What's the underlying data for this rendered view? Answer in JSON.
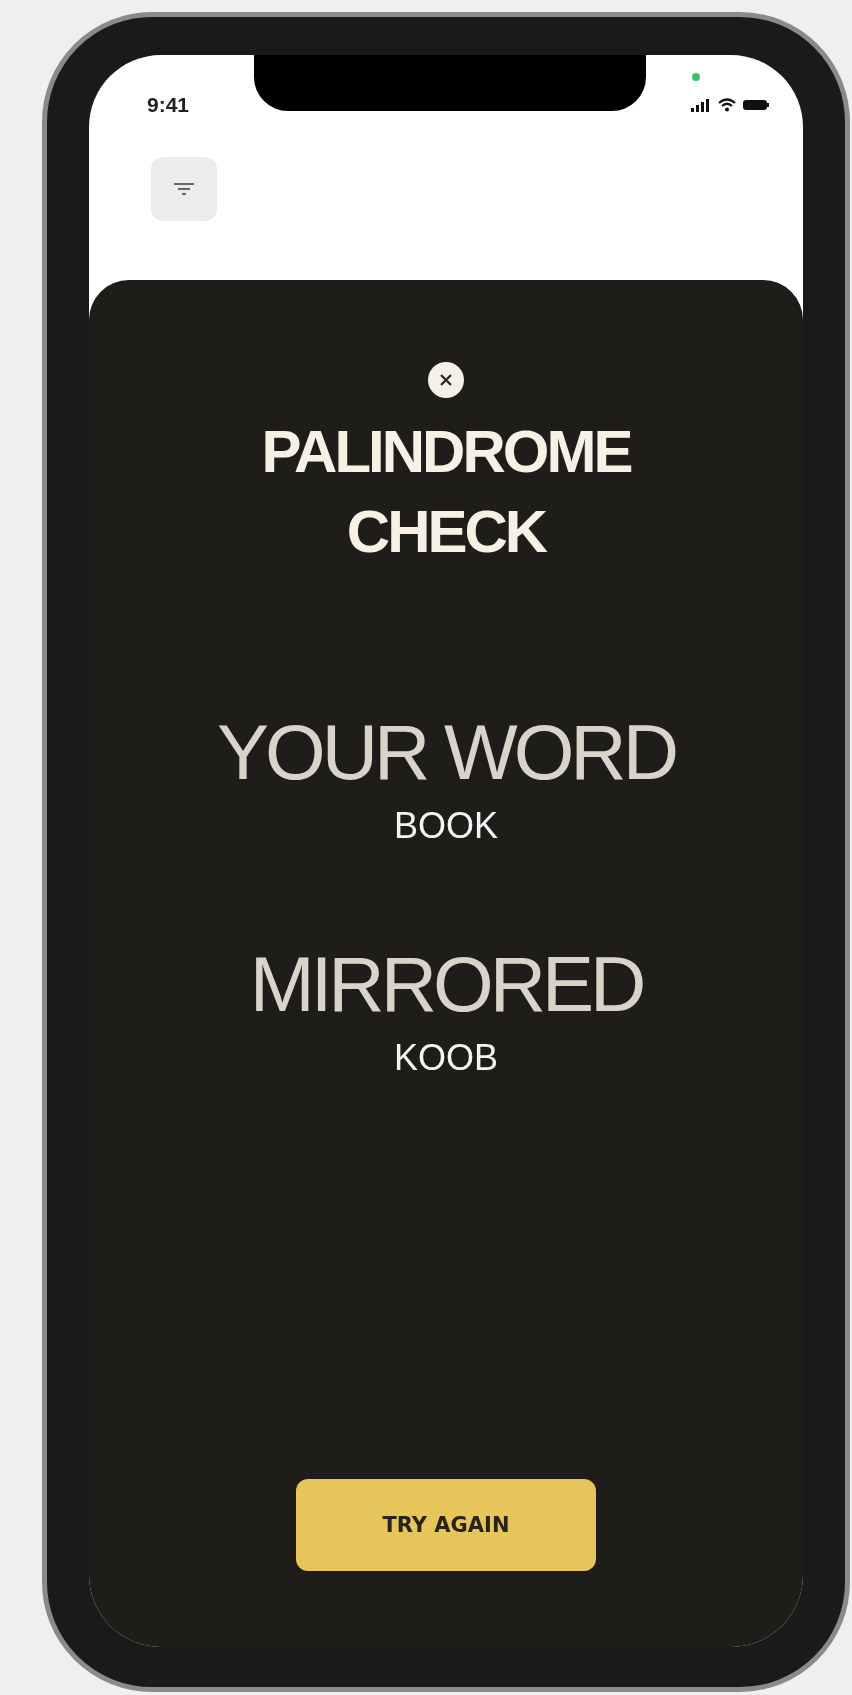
{
  "status_bar": {
    "time": "9:41"
  },
  "dialog": {
    "title_lines": [
      "PALINDROME",
      "CHECK"
    ],
    "results": [
      {
        "label": "YOUR WORD",
        "value": "BOOK"
      },
      {
        "label": "MIRRORED",
        "value": "KOOB"
      }
    ],
    "button": "TRY AGAIN"
  }
}
